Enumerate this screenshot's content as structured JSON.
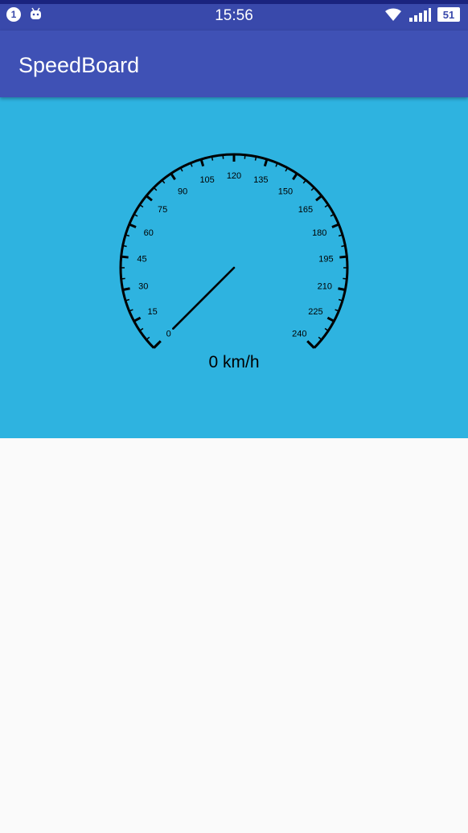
{
  "status_bar": {
    "notification_count": "1",
    "time": "15:56",
    "battery": "51",
    "icons": [
      "notification-badge-icon",
      "android-icon",
      "wifi-icon",
      "signal-icon",
      "battery-icon"
    ]
  },
  "app_bar": {
    "title": "SpeedBoard"
  },
  "speedometer": {
    "speed_readout": "0 km/h",
    "current_speed": 0,
    "min": 0,
    "max": 240,
    "tick_labels": [
      "0",
      "15",
      "30",
      "45",
      "60",
      "75",
      "90",
      "105",
      "120",
      "135",
      "150",
      "165",
      "180",
      "195",
      "210",
      "225",
      "240"
    ]
  },
  "colors": {
    "status_bar": "#3949ab",
    "app_bar": "#3f51b5",
    "gauge_background": "#2eb3e0",
    "content_background": "#fafafa",
    "gauge_ink": "#000000"
  }
}
